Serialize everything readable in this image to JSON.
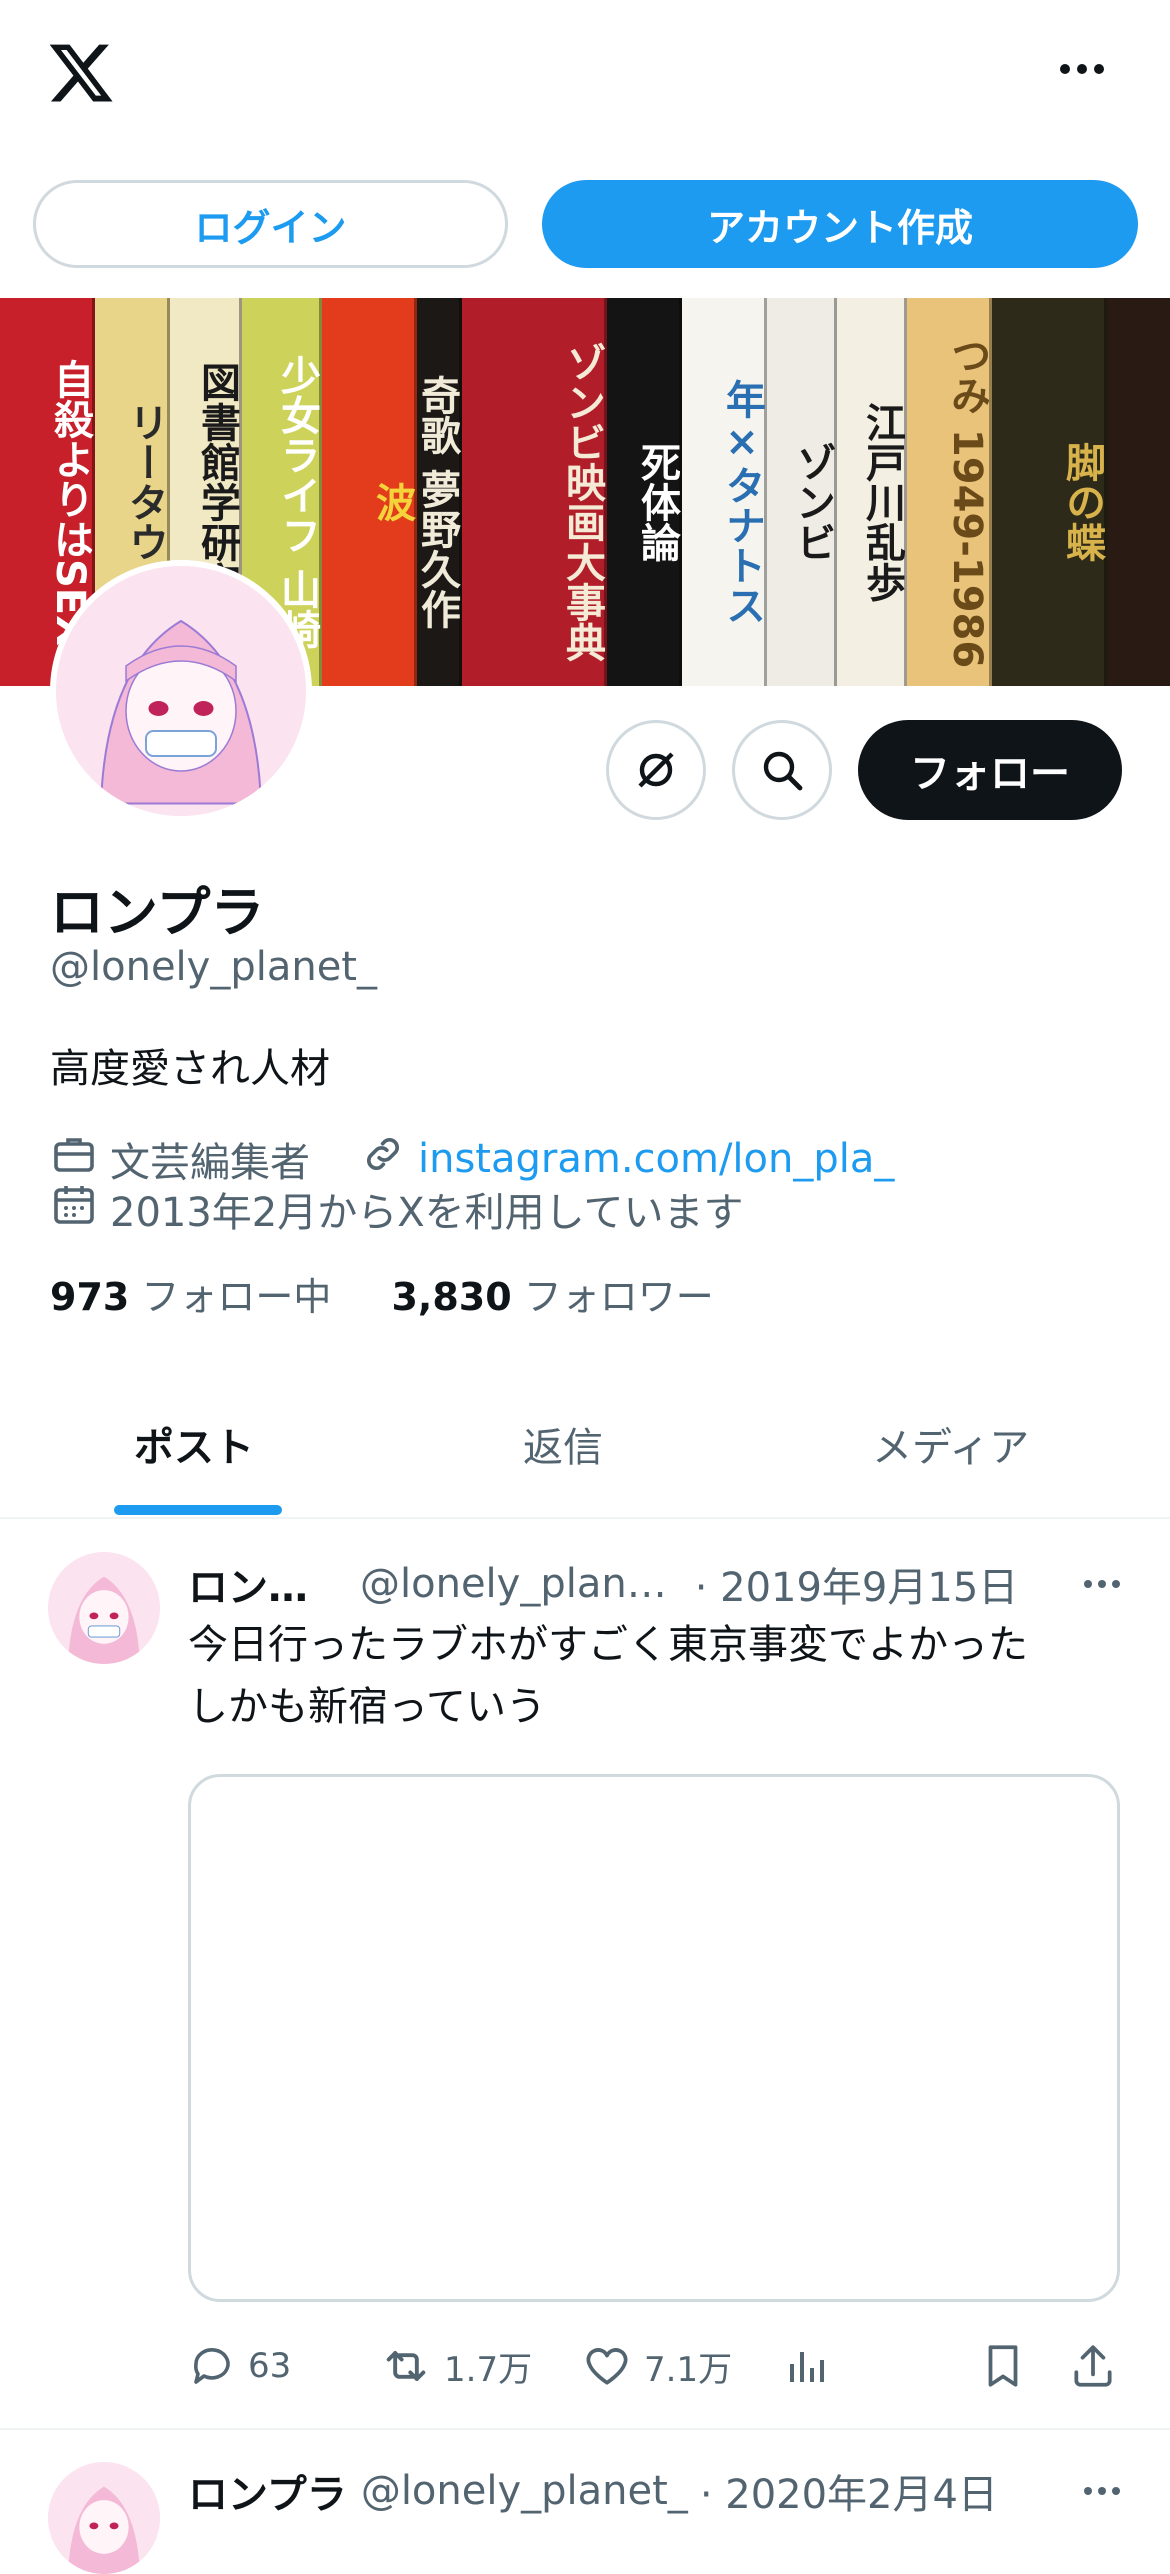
{
  "topbar": {
    "logo": "x-logo-icon",
    "more": "more-icon"
  },
  "auth": {
    "login_label": "ログイン",
    "signup_label": "アカウント作成"
  },
  "banner": {
    "spines": [
      {
        "text": "自殺よりはSEX",
        "bg": "#c8202a",
        "fg": "#ffffff"
      },
      {
        "text": "リータウイ",
        "bg": "#e8d58a",
        "fg": "#2b2b2b"
      },
      {
        "text": "図書館学研究入",
        "bg": "#f1e9c4",
        "fg": "#1a1a1a"
      },
      {
        "text": "少女ライフ 山崎",
        "bg": "#cdd35a",
        "fg": "#ffffff"
      },
      {
        "text": "波",
        "bg": "#e23c1c",
        "fg": "#f5d33a"
      },
      {
        "text": "奇歌 夢野久作",
        "bg": "#1c1815",
        "fg": "#f0ead8"
      },
      {
        "text": "ゾンビ映画大事典",
        "bg": "#b11e2a",
        "fg": "#f4ead5"
      },
      {
        "text": "死体論",
        "bg": "#141414",
        "fg": "#ffffff"
      },
      {
        "text": "年×タナトス",
        "bg": "#f5f4ef",
        "fg": "#2a6fb2"
      },
      {
        "text": "ゾンビ",
        "bg": "#efece5",
        "fg": "#1a1a1a"
      },
      {
        "text": "江戸川乱歩",
        "bg": "#f3efe2",
        "fg": "#1a1a1a"
      },
      {
        "text": "つみ 1949-1986",
        "bg": "#e9c37a",
        "fg": "#6b4a1a"
      },
      {
        "text": "脚の蝶",
        "bg": "#2d2a1a",
        "fg": "#d8b24a"
      }
    ]
  },
  "profile": {
    "name": "ロンプラ",
    "handle": "@lonely_planet_",
    "bio": "高度愛され人材",
    "job": "文芸編集者",
    "link": "instagram.com/lon_pla_",
    "joined": "2013年2月からXを利用しています",
    "following_count": "973",
    "following_label": "フォロー中",
    "followers_count": "3,830",
    "followers_label": "フォロワー",
    "follow_label": "フォロー"
  },
  "tabs": [
    {
      "label": "ポスト"
    },
    {
      "label": "返信"
    },
    {
      "label": "メディア"
    }
  ],
  "posts": [
    {
      "name": "ロン…",
      "handle": "@lonely_plan…",
      "date": "· 2019年9月15日",
      "text_line1": "今日行ったラブホがすごく東京事変でよかった",
      "text_line2": "しかも新宿っていう",
      "replies": "63",
      "reposts": "1.7万",
      "likes": "7.1万"
    },
    {
      "name": "ロンプラ",
      "handle": "@lonely_planet_",
      "date": "· 2020年2月4日"
    }
  ],
  "colors": {
    "accent": "#1d9bf0",
    "text": "#0f1419",
    "muted": "#536471",
    "border": "#cfd9de"
  }
}
